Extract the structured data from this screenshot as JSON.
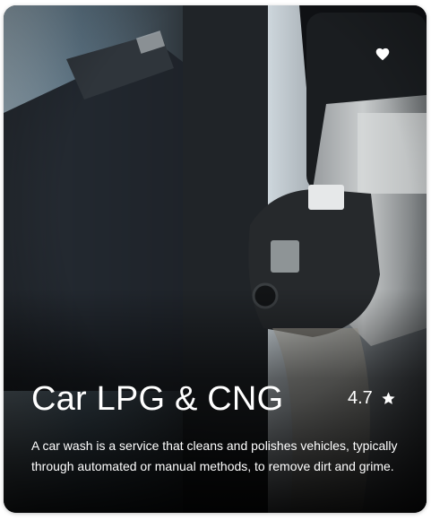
{
  "card": {
    "title": "Car LPG & CNG",
    "rating": "4.7",
    "description": "A car wash is a service that cleans and polishes vehicles, typically through automated or manual methods, to remove dirt and grime.",
    "favorite_icon": "heart-icon",
    "rating_icon": "star-icon"
  },
  "colors": {
    "text": "#ffffff",
    "card_background": "#15181b"
  }
}
